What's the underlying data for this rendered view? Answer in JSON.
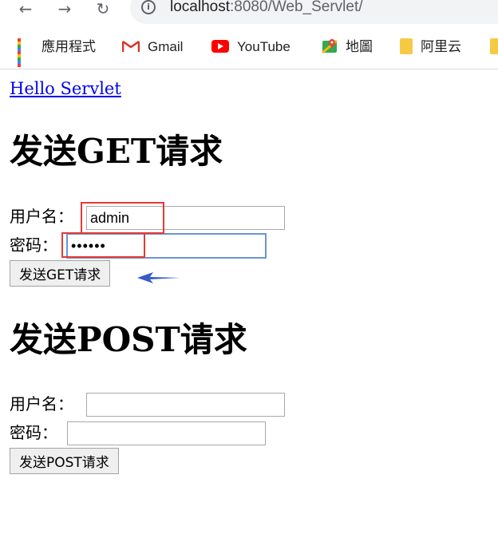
{
  "browser": {
    "url_host": "localhost",
    "url_path": ":8080/Web_Servlet/",
    "bookmarks": [
      {
        "label": "應用程式",
        "icon": "apps-grid-icon"
      },
      {
        "label": "Gmail",
        "icon": "gmail-icon"
      },
      {
        "label": "YouTube",
        "icon": "youtube-icon"
      },
      {
        "label": "地圖",
        "icon": "maps-icon"
      },
      {
        "label": "阿里云",
        "icon": "folder-icon"
      }
    ]
  },
  "page": {
    "link_text": "Hello Servlet",
    "get_form": {
      "heading": "发送GET请求",
      "username_label": "用户名：",
      "username_value": "admin",
      "password_label": "密码：",
      "password_value": "••••••",
      "submit_label": "发送GET请求"
    },
    "post_form": {
      "heading": "发送POST请求",
      "username_label": "用户名：",
      "username_value": "",
      "password_label": "密码：",
      "password_value": "",
      "submit_label": "发送POST请求"
    }
  },
  "annotations": {
    "highlight_color": "#e53935",
    "arrow_color": "#3a5bc7"
  }
}
